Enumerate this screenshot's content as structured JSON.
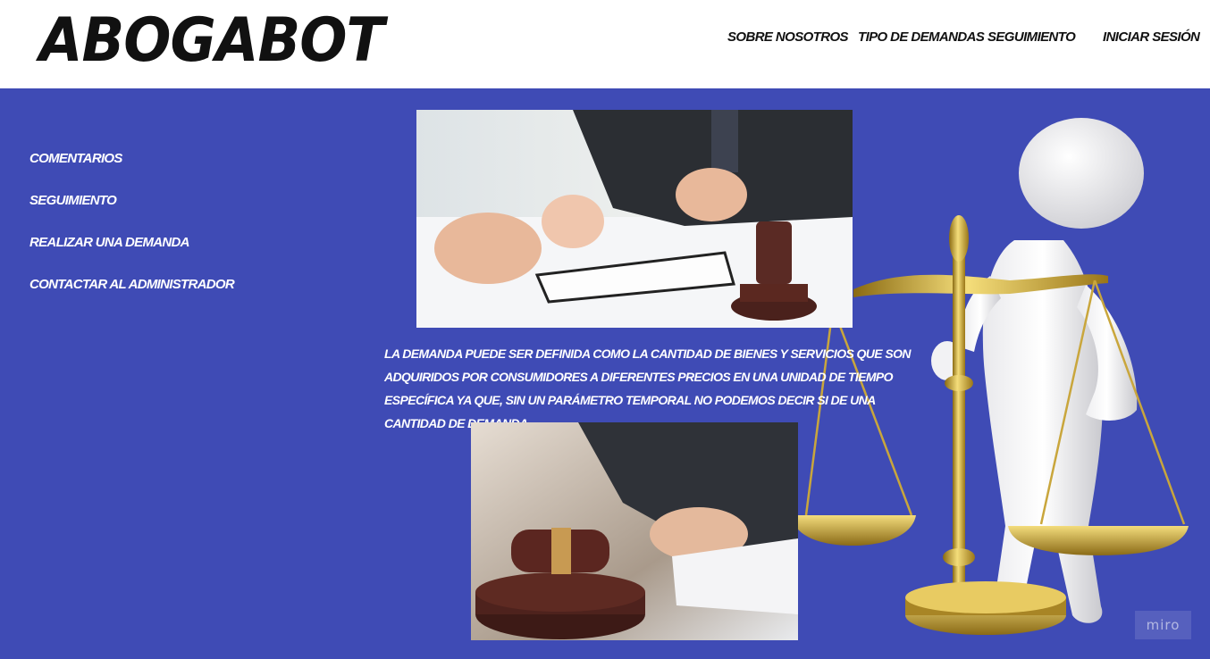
{
  "header": {
    "logo": "ABOGABOT",
    "nav": [
      {
        "label": "SOBRE NOSOTROS"
      },
      {
        "label": "TIPO DE DEMANDAS"
      },
      {
        "label": "SEGUIMIENTO"
      },
      {
        "label": "INICIAR SESIÓN"
      }
    ]
  },
  "sidebar": {
    "items": [
      {
        "label": "COMENTARIOS"
      },
      {
        "label": "SEGUIMIENTO"
      },
      {
        "label": "REALIZAR UNA DEMANDA"
      },
      {
        "label": "CONTACTAR AL ADMINISTRADOR"
      }
    ]
  },
  "content": {
    "description": "LA DEMANDA PUEDE SER DEFINIDA COMO LA CANTIDAD DE BIENES Y SERVICIOS QUE SON ADQUIRIDOS POR CONSUMIDORES A DIFERENTES PRECIOS EN UNA UNIDAD DE TIEMPO ESPECÍFICA YA QUE, SIN UN PARÁMETRO TEMPORAL NO PODEMOS DECIR SI DE UNA CANTIDAD DE DEMANDA"
  },
  "watermark": "miro",
  "colors": {
    "background": "#3f4bb5",
    "header": "#ffffff",
    "text_dark": "#111111",
    "text_light": "#ffffff"
  }
}
